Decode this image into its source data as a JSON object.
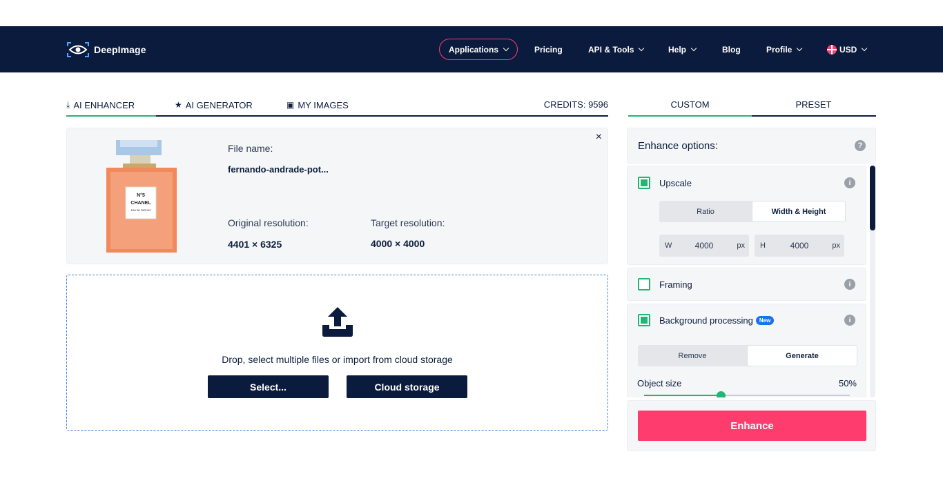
{
  "brand": {
    "name": "DeepImage"
  },
  "nav": {
    "applications": "Applications",
    "pricing": "Pricing",
    "api_tools": "API & Tools",
    "help": "Help",
    "blog": "Blog",
    "profile": "Profile",
    "currency": "USD"
  },
  "tabs": {
    "enhancer": "AI ENHANCER",
    "generator": "AI GENERATOR",
    "my_images": "MY IMAGES",
    "credits": "CREDITS: 9596"
  },
  "file": {
    "name_label": "File name:",
    "name_value": "fernando-andrade-pot...",
    "orig_label": "Original resolution:",
    "orig_value": "4401 × 6325",
    "target_label": "Target resolution:",
    "target_value": "4000 × 4000",
    "close": "×",
    "bottle_lines": [
      "N°5",
      "CHANEL",
      "EAU DE PARFUM"
    ]
  },
  "dropzone": {
    "text": "Drop, select multiple files or import from cloud storage",
    "select": "Select...",
    "cloud": "Cloud storage"
  },
  "panel": {
    "tab_custom": "CUSTOM",
    "tab_preset": "PRESET",
    "header": "Enhance options:",
    "help": "?",
    "info": "i",
    "upscale": {
      "title": "Upscale",
      "checked": true,
      "mode_ratio": "Ratio",
      "mode_wh": "Width & Height",
      "w_label": "W",
      "w_value": "4000",
      "h_label": "H",
      "h_value": "4000",
      "unit": "px"
    },
    "framing": {
      "title": "Framing",
      "checked": false
    },
    "background": {
      "title": "Background processing",
      "badge": "New",
      "checked": true,
      "remove": "Remove",
      "generate": "Generate"
    },
    "object_size": {
      "label": "Object size",
      "value_text": "50%",
      "value": 0.5
    },
    "enhance": "Enhance"
  },
  "colors": {
    "navy": "#0b1b3d",
    "accent": "#ff3c6e",
    "green": "#22b573",
    "blue": "#1a73e8"
  }
}
